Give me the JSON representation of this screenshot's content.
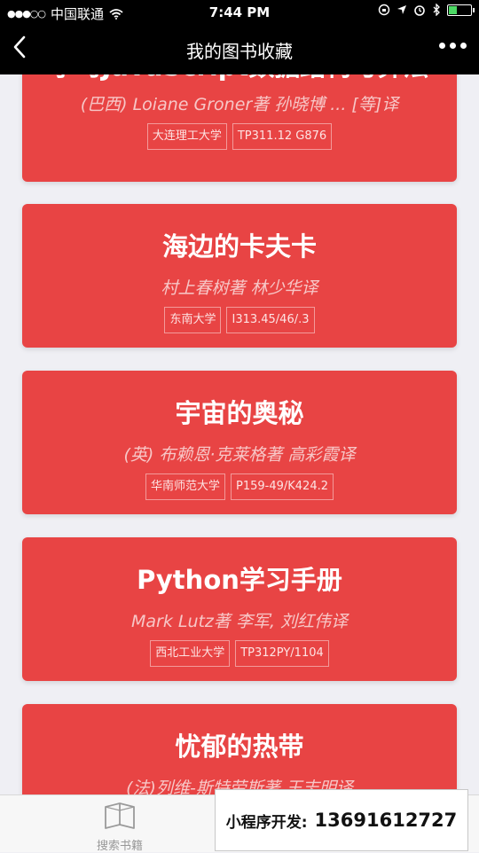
{
  "status_bar": {
    "signal": "●●●○○",
    "carrier": "中国联通",
    "time": "7:44 PM"
  },
  "nav": {
    "title": "我的图书收藏",
    "back_icon": "chevron-left-icon",
    "more_icon": "more-dots-icon"
  },
  "books": [
    {
      "title": "学习JavaScript数据结构与算法",
      "author": "(巴西) Loiane Groner著 孙晓博 ... [等]译",
      "library": "大连理工大学",
      "call_number": "TP311.12 G876"
    },
    {
      "title": "海边的卡夫卡",
      "author": "村上春树著 林少华译",
      "library": "东南大学",
      "call_number": "I313.45/46/.3"
    },
    {
      "title": "宇宙的奥秘",
      "author": "(英) 布赖恩·克莱格著 高彩霞译",
      "library": "华南师范大学",
      "call_number": "P159-49/K424.2"
    },
    {
      "title": "Python学习手册",
      "author": "Mark Lutz著 李军, 刘红伟译",
      "library": "西北工业大学",
      "call_number": "TP312PY/1104"
    },
    {
      "title": "忧郁的热带",
      "author": "(法)列维-斯特劳斯著 王志明译",
      "library": "",
      "call_number": ""
    }
  ],
  "tabbar": {
    "search_label": "搜索书籍",
    "search_icon": "book-icon"
  },
  "ad": {
    "label": "小程序开发:",
    "phone": "13691612727"
  },
  "colors": {
    "card": "#e84444",
    "nav_bg": "#000000",
    "page_bg": "#efeff4"
  }
}
